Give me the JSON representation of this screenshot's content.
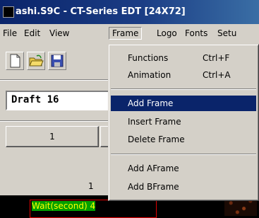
{
  "window": {
    "title": "ashi.S9C - CT-Series EDT  [24X72]"
  },
  "menubar": {
    "items": [
      {
        "name": "menu-file",
        "label": "File"
      },
      {
        "name": "menu-edit",
        "label": "Edit"
      },
      {
        "name": "menu-view",
        "label": "View"
      },
      {
        "name": "menu-frame",
        "label": "Frame"
      },
      {
        "name": "menu-logo",
        "label": "Logo"
      },
      {
        "name": "menu-fonts",
        "label": "Fonts"
      },
      {
        "name": "menu-setup",
        "label": "Setu"
      }
    ]
  },
  "toolbar": {
    "icons": [
      "new-file-icon",
      "open-folder-icon",
      "save-icon"
    ]
  },
  "draft": {
    "value": "Draft 16"
  },
  "panel": {
    "button1_label": "1",
    "row_number": "1"
  },
  "status": {
    "wait_text": "Wait(second) 4"
  },
  "frame_menu": {
    "items": [
      {
        "label": "Functions",
        "shortcut": "Ctrl+F"
      },
      {
        "label": "Animation",
        "shortcut": "Ctrl+A"
      },
      {
        "label": "Add Frame",
        "shortcut": "",
        "selected": true
      },
      {
        "label": "Insert Frame",
        "shortcut": ""
      },
      {
        "label": "Delete Frame",
        "shortcut": ""
      },
      {
        "label": "Add AFrame",
        "shortcut": ""
      },
      {
        "label": "Add BFrame",
        "shortcut": ""
      }
    ]
  },
  "colors": {
    "titlebar": "#0a246a",
    "menu_highlight": "#0a246a",
    "status_text": "#ffff00",
    "status_border": "#e00000"
  }
}
